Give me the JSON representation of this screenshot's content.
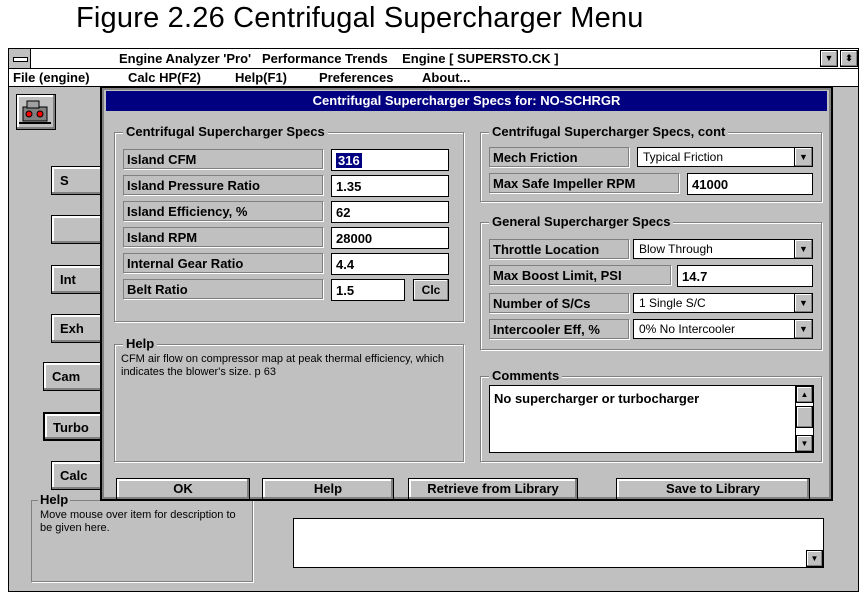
{
  "caption": "Figure 2.26  Centrifugal Supercharger Menu",
  "window": {
    "title": "Engine Analyzer 'Pro'   Performance Trends    Engine [ SUPERSTO.CK ]",
    "menu": [
      "File (engine)",
      "Calc HP(F2)",
      "Help(F1)",
      "Preferences",
      "About..."
    ]
  },
  "background": {
    "buttons": [
      "S",
      "Int",
      "Exh",
      "Cam",
      "Turbo",
      "Calc"
    ],
    "help_title": "Help",
    "help_text": "Move mouse over item for description to be given here."
  },
  "dialog": {
    "title": "Centrifugal Supercharger Specs for: NO-SCHRGR",
    "left_group": {
      "title": "Centrifugal Supercharger Specs",
      "fields": [
        {
          "label": "Island CFM",
          "value": "316"
        },
        {
          "label": "Island Pressure Ratio",
          "value": "1.35"
        },
        {
          "label": "Island Efficiency, %",
          "value": "62"
        },
        {
          "label": "Island RPM",
          "value": "28000"
        },
        {
          "label": "Internal Gear Ratio",
          "value": "4.4"
        },
        {
          "label": "Belt Ratio",
          "value": "1.5"
        }
      ],
      "clc_label": "Clc"
    },
    "cont_group": {
      "title": "Centrifugal Supercharger Specs, cont",
      "mech_friction_label": "Mech Friction",
      "mech_friction_value": "Typical Friction",
      "max_rpm_label": "Max Safe Impeller RPM",
      "max_rpm_value": "41000"
    },
    "general_group": {
      "title": "General Supercharger Specs",
      "throttle_label": "Throttle Location",
      "throttle_value": "Blow Through",
      "boost_label": "Max Boost Limit, PSI",
      "boost_value": "14.7",
      "num_label": "Number of S/Cs",
      "num_value": "1 Single S/C",
      "intercooler_label": "Intercooler Eff, %",
      "intercooler_value": "0%  No Intercooler"
    },
    "help": {
      "title": "Help",
      "text": "CFM air flow on compressor map at peak thermal efficiency, which indicates the blower's size.  p 63"
    },
    "comments": {
      "title": "Comments",
      "text": "No supercharger or turbocharger"
    },
    "buttons": {
      "ok": "OK",
      "help": "Help",
      "retrieve": "Retrieve from Library",
      "save": "Save to Library"
    }
  }
}
